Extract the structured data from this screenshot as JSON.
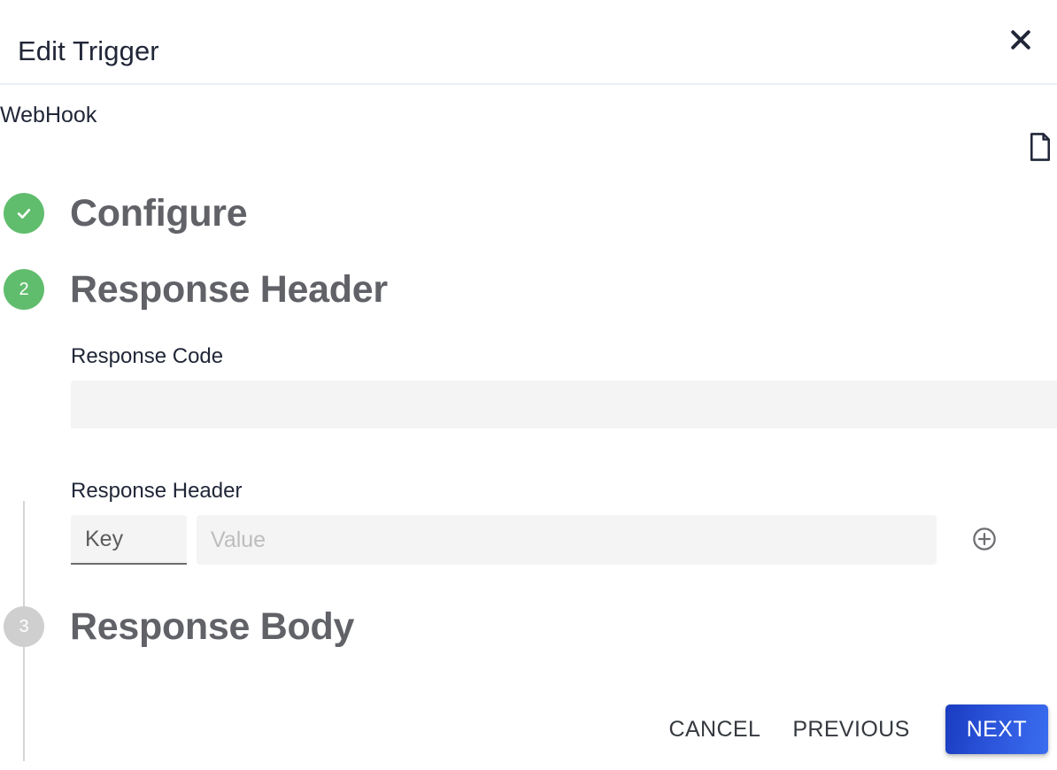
{
  "dialog": {
    "title": "Edit Trigger",
    "close_icon": "close-icon",
    "trigger_type": "WebHook",
    "doc_icon": "document-icon"
  },
  "stepper": {
    "steps": [
      {
        "marker": "✓",
        "label": "Configure",
        "state": "done"
      },
      {
        "marker": "2",
        "label": "Response Header",
        "state": "active"
      },
      {
        "marker": "3",
        "label": "Response Body",
        "state": "todo"
      }
    ]
  },
  "form": {
    "response_code": {
      "label": "Response Code",
      "value": "",
      "placeholder": ""
    },
    "response_header": {
      "label": "Response Header",
      "key_value": "Key",
      "key_placeholder": "Key",
      "value_value": "",
      "value_placeholder": "Value",
      "add_icon": "plus-circle-icon"
    }
  },
  "footer": {
    "cancel_label": "CANCEL",
    "previous_label": "PREVIOUS",
    "next_label": "NEXT"
  },
  "colors": {
    "step_done": "#60bd6d",
    "step_active": "#60bd6d",
    "step_todo": "#cfcfcf",
    "primary_button_start": "#1a3cc0",
    "primary_button_end": "#3a6df0",
    "title_text": "#212738",
    "step_label_text": "#616268",
    "input_background": "#f4f4f4",
    "placeholder_text": "#bdbdbd"
  }
}
